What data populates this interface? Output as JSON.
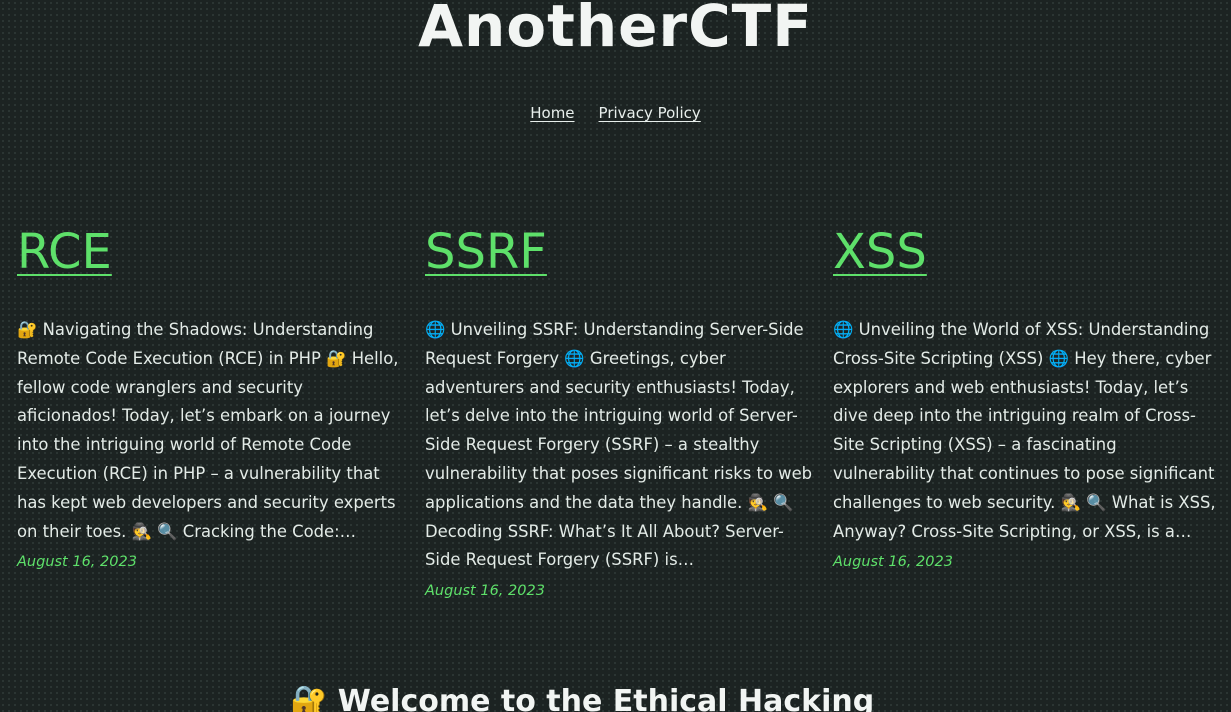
{
  "site": {
    "title": "AnotherCTF"
  },
  "nav": {
    "items": [
      {
        "label": "Home"
      },
      {
        "label": "Privacy Policy"
      }
    ]
  },
  "posts": [
    {
      "title": "RCE",
      "excerpt": "🔐 Navigating the Shadows: Understanding Remote Code Execution (RCE) in PHP 🔐 Hello, fellow code wranglers and security aficionados! Today, let’s embark on a journey into the intriguing world of Remote Code Execution (RCE) in PHP – a vulnerability that has kept web developers and security experts on their toes. 🕵️ 🔍 Cracking the Code:…",
      "date": "August 16, 2023"
    },
    {
      "title": "SSRF",
      "excerpt": "🌐 Unveiling SSRF: Understanding Server-Side Request Forgery 🌐 Greetings, cyber adventurers and security enthusiasts! Today, let’s delve into the intriguing world of Server-Side Request Forgery (SSRF) – a stealthy vulnerability that poses significant risks to web applications and the data they handle. 🕵️ 🔍 Decoding SSRF: What’s It All About? Server-Side Request Forgery (SSRF) is…",
      "date": "August 16, 2023"
    },
    {
      "title": "XSS",
      "excerpt": "🌐 Unveiling the World of XSS: Understanding Cross-Site Scripting (XSS) 🌐 Hey there, cyber explorers and web enthusiasts! Today, let’s dive deep into the intriguing realm of Cross-Site Scripting (XSS) – a fascinating vulnerability that continues to pose significant challenges to web security. 🕵️ 🔍 What is XSS, Anyway? Cross-Site Scripting, or XSS, is a…",
      "date": "August 16, 2023"
    }
  ],
  "welcome": {
    "heading": "🔐 Welcome to the Ethical Hacking"
  }
}
